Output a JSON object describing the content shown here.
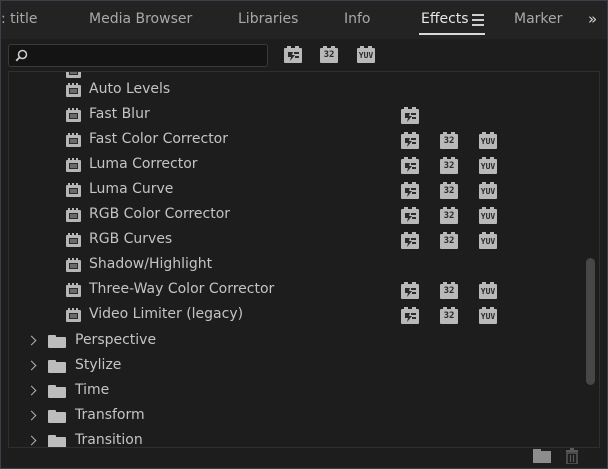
{
  "tabs": [
    {
      "label": ": title",
      "active": false
    },
    {
      "label": "Media Browser",
      "active": false
    },
    {
      "label": "Libraries",
      "active": false
    },
    {
      "label": "Info",
      "active": false
    },
    {
      "label": "Effects",
      "active": true
    },
    {
      "label": "Marker",
      "active": false
    }
  ],
  "overflow_label": "»",
  "search": {
    "value": "",
    "placeholder": ""
  },
  "filters": {
    "accelerated_icon": "accelerated-effects-icon",
    "bit32_label": "32",
    "yuv_label": "YUV"
  },
  "effects": [
    {
      "label": "Auto Levels",
      "accel": false,
      "bit32": false,
      "yuv": false
    },
    {
      "label": "Fast Blur",
      "accel": true,
      "bit32": false,
      "yuv": false
    },
    {
      "label": "Fast Color Corrector",
      "accel": true,
      "bit32": true,
      "yuv": true
    },
    {
      "label": "Luma Corrector",
      "accel": true,
      "bit32": true,
      "yuv": true
    },
    {
      "label": "Luma Curve",
      "accel": true,
      "bit32": true,
      "yuv": true
    },
    {
      "label": "RGB Color Corrector",
      "accel": true,
      "bit32": true,
      "yuv": true
    },
    {
      "label": "RGB Curves",
      "accel": true,
      "bit32": true,
      "yuv": true
    },
    {
      "label": "Shadow/Highlight",
      "accel": false,
      "bit32": false,
      "yuv": false
    },
    {
      "label": "Three-Way Color Corrector",
      "accel": true,
      "bit32": true,
      "yuv": true
    },
    {
      "label": "Video Limiter (legacy)",
      "accel": true,
      "bit32": true,
      "yuv": true
    }
  ],
  "folders": [
    {
      "label": "Perspective"
    },
    {
      "label": "Stylize"
    },
    {
      "label": "Time"
    },
    {
      "label": "Transform"
    },
    {
      "label": "Transition"
    }
  ],
  "colors": {
    "panel": "#1d1d1d",
    "tabbar": "#232323",
    "icon": "#b9b9b9",
    "text": "#c4c4c4"
  }
}
